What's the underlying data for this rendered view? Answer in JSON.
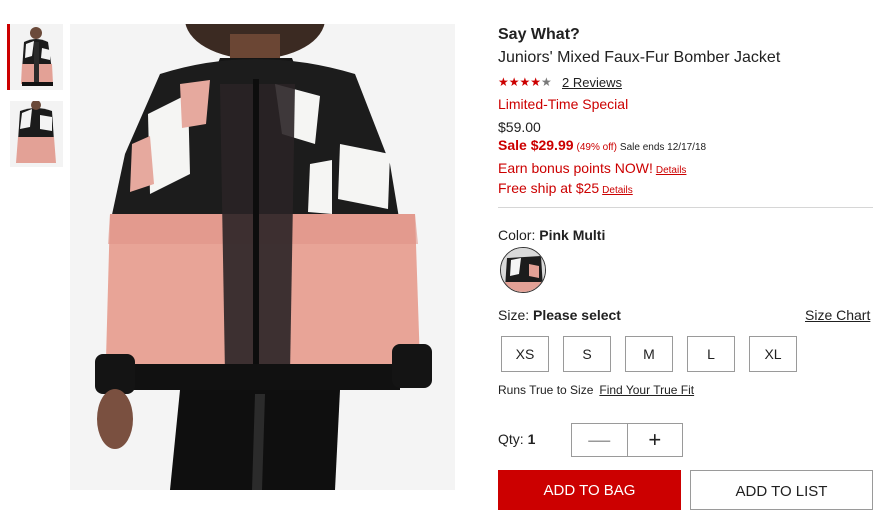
{
  "product": {
    "brand": "Say What?",
    "title": "Juniors' Mixed Faux-Fur Bomber Jacket",
    "rating_stars": "★★★★",
    "rating_star_empty": "★",
    "reviews_link": "2 Reviews",
    "promo_label": "Limited-Time Special",
    "original_price": "$59.00",
    "sale_price": "Sale $29.99",
    "discount": "(49% off)",
    "sale_ends": "Sale ends 12/17/18",
    "bonus_text": "Earn bonus points NOW!",
    "free_ship_text": "Free ship at $25",
    "details_label": "Details"
  },
  "color": {
    "label": "Color:",
    "value": "Pink Multi"
  },
  "size": {
    "label": "Size:",
    "value": "Please select",
    "chart_link": "Size Chart",
    "options": [
      "XS",
      "S",
      "M",
      "L",
      "XL"
    ],
    "runs_text": "Runs True to Size",
    "fit_link": "Find Your True Fit"
  },
  "quantity": {
    "label": "Qty:",
    "value": "1",
    "minus": "—",
    "plus": "+"
  },
  "actions": {
    "add_to_bag": "ADD TO BAG",
    "add_to_list": "ADD TO LIST"
  },
  "colors": {
    "accent": "#cc0000",
    "text": "#212121",
    "border": "#9a9a9a"
  }
}
